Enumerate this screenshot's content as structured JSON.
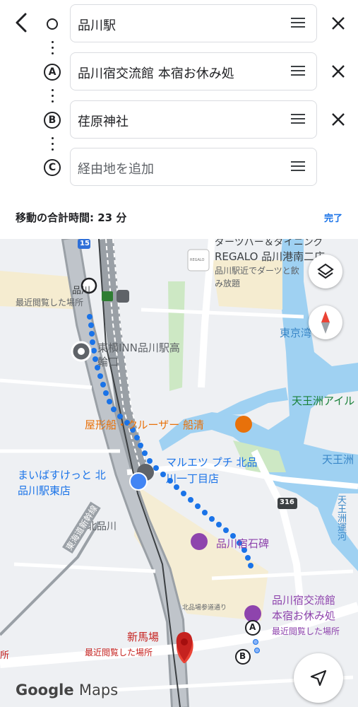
{
  "header": {
    "stops": [
      {
        "marker": "",
        "text": "品川駅",
        "removable": true
      },
      {
        "marker": "A",
        "text": "品川宿交流館 本宿お休み処",
        "removable": true
      },
      {
        "marker": "B",
        "text": "荏原神社",
        "removable": true
      },
      {
        "marker": "C",
        "text": "経由地を追加",
        "placeholder": true
      }
    ],
    "total_time_label": "移動の合計時間: 23 分",
    "done_label": "完了"
  },
  "map": {
    "labels": {
      "ad_name": "REGALO 品川港南二店",
      "ad_top": "ダーツバー＆ダイニング",
      "ad_desc1": "品川駅近でダーツと飲",
      "ad_desc2": "み放題",
      "regalo_logo": "REGALO",
      "station_short": "品川",
      "recent1": "最近閲覧した場所",
      "toyoko1": "東横INN品川駅高",
      "toyoko2": "輪口",
      "tokyo_bay": "東京湾",
      "tennozu": "天王洲アイル",
      "tennozu2": "天王洲",
      "yakatabune": "屋形船・クルーザー 船清",
      "maruetsu1": "マルエツ プチ 北品",
      "maruetsu2": "川一丁目店",
      "maibasu1": "まいばすけっと 北",
      "maibasu2": "品川駅東店",
      "route316": "316",
      "tennozu_canal": "天王洲運河",
      "kitashinagawa": "北品川",
      "shukusekihi": "品川宿石碑",
      "shinkansen": "東海道新幹線",
      "koryukan1": "品川宿交流館",
      "koryukan2": "本宿お休み処",
      "recent2": "最近閲覧した場所",
      "sandou": "北品場参道通り",
      "shinbaba": "新馬場",
      "recent3": "最近閲覧した場所",
      "sho": "所",
      "road15": "15",
      "google": "Google",
      "maps": "Maps"
    },
    "markers": {
      "a": "A",
      "b": "B"
    },
    "colors": {
      "route": "#1a73e8",
      "poi_purple": "#8e44ad",
      "poi_orange": "#e8710a",
      "poi_blue": "#4285f4",
      "pin_red": "#ea4335",
      "water": "#9fd1f2",
      "park": "#cde8c4",
      "rail": "#9aa0a6"
    }
  }
}
